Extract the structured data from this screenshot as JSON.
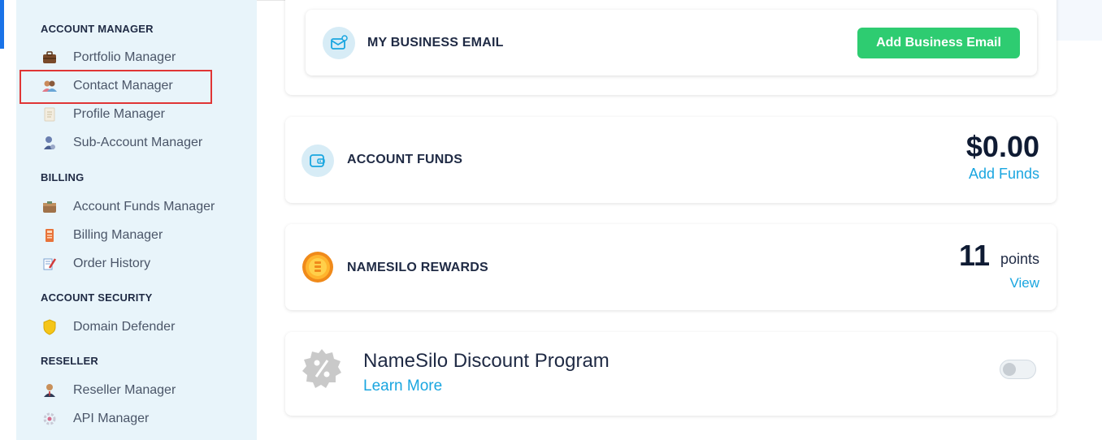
{
  "sidebar": {
    "sections": [
      {
        "title": "ACCOUNT MANAGER"
      },
      {
        "title": "BILLING"
      },
      {
        "title": "ACCOUNT SECURITY"
      },
      {
        "title": "RESELLER"
      }
    ],
    "items": [
      {
        "label": "Portfolio Manager",
        "icon": "briefcase-icon"
      },
      {
        "label": "Contact Manager",
        "icon": "contacts-icon"
      },
      {
        "label": "Profile Manager",
        "icon": "profile-icon"
      },
      {
        "label": "Sub-Account Manager",
        "icon": "sub-account-icon"
      },
      {
        "label": "Account Funds Manager",
        "icon": "wallet-icon"
      },
      {
        "label": "Billing Manager",
        "icon": "billing-icon"
      },
      {
        "label": "Order History",
        "icon": "order-history-icon"
      },
      {
        "label": "Domain Defender",
        "icon": "shield-icon"
      },
      {
        "label": "Reseller Manager",
        "icon": "reseller-icon"
      },
      {
        "label": "API Manager",
        "icon": "api-icon"
      }
    ]
  },
  "business_email": {
    "title": "MY BUSINESS EMAIL",
    "button": "Add Business Email",
    "icon": "mail-icon"
  },
  "account_funds": {
    "title": "ACCOUNT FUNDS",
    "amount": "$0.00",
    "link": "Add Funds",
    "icon": "wallet-icon"
  },
  "rewards": {
    "title": "NAMESILO REWARDS",
    "points": "11",
    "points_label": "points",
    "link": "View",
    "icon": "coin-icon"
  },
  "discount": {
    "title": "NameSilo Discount Program",
    "link": "Learn More",
    "toggle_on": false,
    "icon": "percent-badge-icon"
  },
  "colors": {
    "accent": "#1aa6e0",
    "button_green": "#2ecc71",
    "sidebar_bg": "#e8f4fa",
    "highlight": "#e03535"
  }
}
